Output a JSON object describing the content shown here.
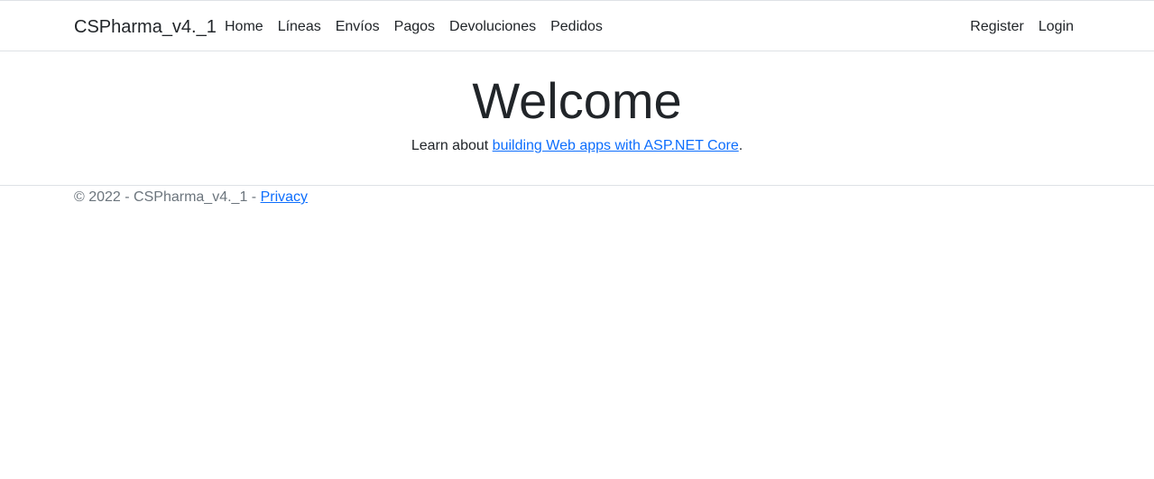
{
  "navbar": {
    "brand": "CSPharma_v4._1",
    "left_links": [
      "Home",
      "Líneas",
      "Envíos",
      "Pagos",
      "Devoluciones",
      "Pedidos"
    ],
    "right_links": [
      "Register",
      "Login"
    ]
  },
  "main": {
    "title": "Welcome",
    "learn_prefix": "Learn about ",
    "learn_link": "building Web apps with ASP.NET Core",
    "learn_suffix": "."
  },
  "footer": {
    "copyright": "© 2022 - CSPharma_v4._1 - ",
    "privacy_link": "Privacy"
  },
  "colors": {
    "link": "#0d6efd",
    "border": "#dee2e6",
    "muted": "#6c757d"
  }
}
